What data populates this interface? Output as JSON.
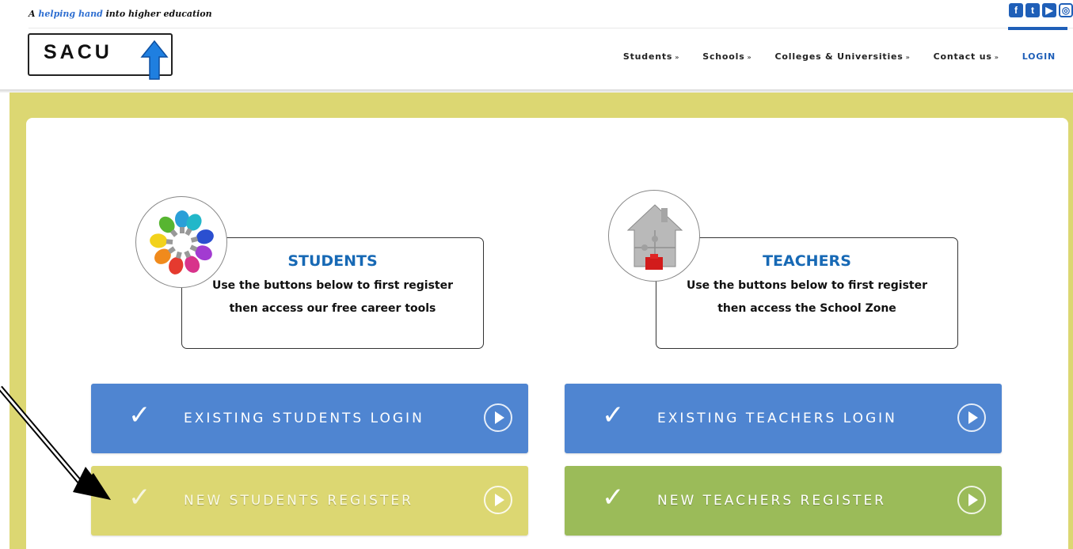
{
  "header": {
    "tagline_prefix": "A",
    "tagline_highlight": "helping hand",
    "tagline_suffix": "into higher education",
    "logo_text": "SACU",
    "social": [
      {
        "name": "facebook-icon",
        "glyph": "f"
      },
      {
        "name": "twitter-icon",
        "glyph": "t"
      },
      {
        "name": "youtube-icon",
        "glyph": "▶"
      },
      {
        "name": "instagram-icon",
        "glyph": "◎"
      }
    ]
  },
  "nav": {
    "items": [
      {
        "label": "Students"
      },
      {
        "label": "Schools"
      },
      {
        "label": "Colleges & Universities"
      },
      {
        "label": "Contact us"
      }
    ],
    "chevron": "»",
    "login": "LOGIN"
  },
  "students": {
    "heading": "STUDENTS",
    "line1": "Use the buttons below to first register",
    "line2": "then access our free career tools"
  },
  "teachers": {
    "heading": "TEACHERS",
    "line1": "Use the buttons below to first register",
    "line2": "then access the School Zone"
  },
  "buttons": {
    "students_login": "EXISTING STUDENTS LOGIN",
    "teachers_login": "EXISTING TEACHERS LOGIN",
    "students_register": "NEW STUDENTS REGISTER",
    "teachers_register": "NEW TEACHERS REGISTER",
    "tick": "✓"
  },
  "colors": {
    "brand_blue": "#1f5fb8",
    "heading_blue": "#1769b5",
    "login_button": "#4f85d1",
    "band_yellow": "#dcd772",
    "green_button": "#9bbb59"
  }
}
